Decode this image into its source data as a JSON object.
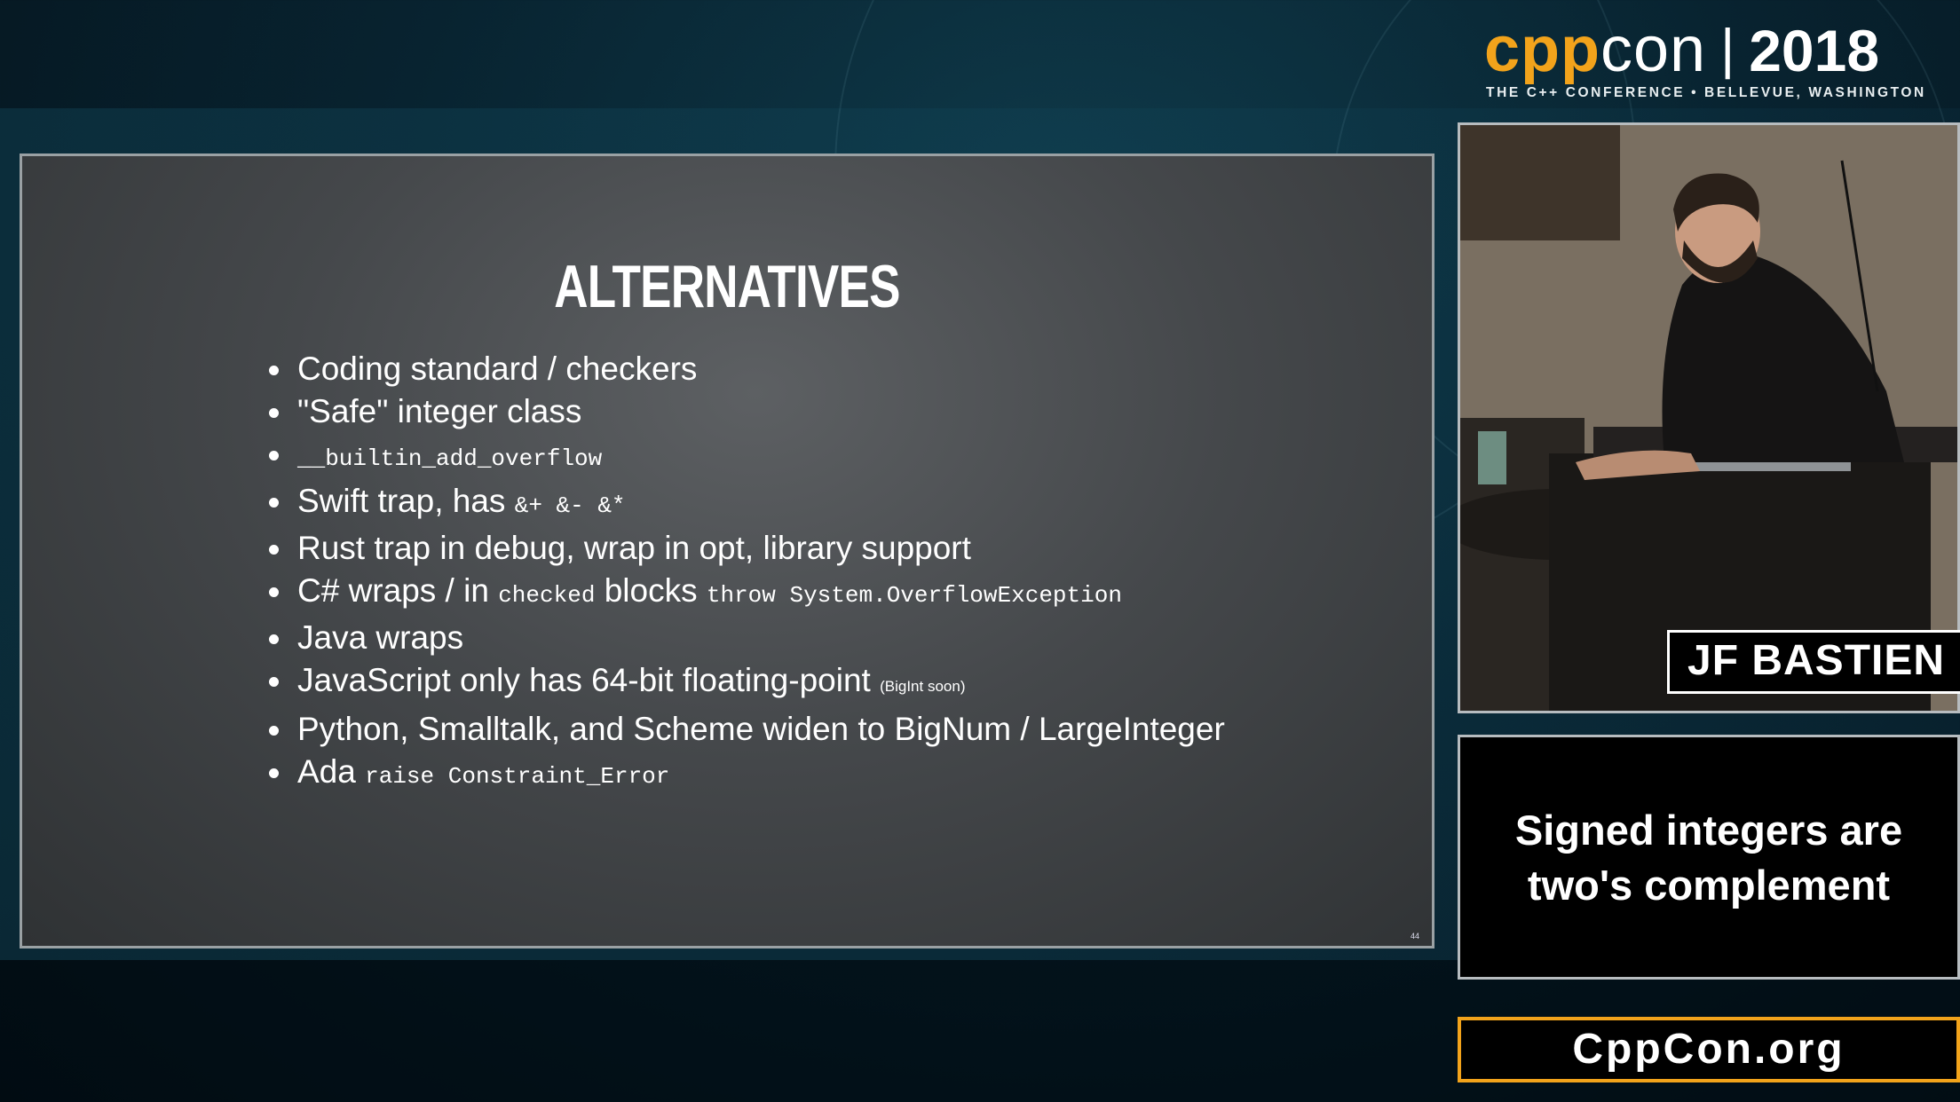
{
  "logo": {
    "cpp": "cpp",
    "con": "con",
    "bar": "|",
    "year": "2018",
    "tagline": "THE C++ CONFERENCE • BELLEVUE, WASHINGTON"
  },
  "slide": {
    "title": "ALTERNATIVES",
    "page_number": "44",
    "bullets": [
      {
        "text": "Coding standard / checkers"
      },
      {
        "text": "\"Safe\" integer class"
      },
      {
        "code": "__builtin_add_overflow"
      },
      {
        "text": "Swift trap, has ",
        "code": "&+ &- &*"
      },
      {
        "text": "Rust trap in debug, wrap in opt, library support"
      },
      {
        "text1": "C# wraps / in ",
        "code1": "checked",
        "text2": " blocks ",
        "code2": "throw System.OverflowException"
      },
      {
        "text": "Java wraps"
      },
      {
        "text": "JavaScript only has 64-bit floating-point ",
        "small": "(BigInt soon)"
      },
      {
        "text": "Python, Smalltalk, and Scheme widen to BigNum / LargeInteger"
      },
      {
        "text": "Ada ",
        "code": "raise Constraint_Error"
      }
    ]
  },
  "speaker": {
    "name": "JF BASTIEN"
  },
  "topic": {
    "line1": "Signed integers are",
    "line2": "two's complement"
  },
  "website": "CppCon.org",
  "colors": {
    "accent": "#f2a31b",
    "background": "#082330",
    "slide_bg": "#45484b"
  }
}
